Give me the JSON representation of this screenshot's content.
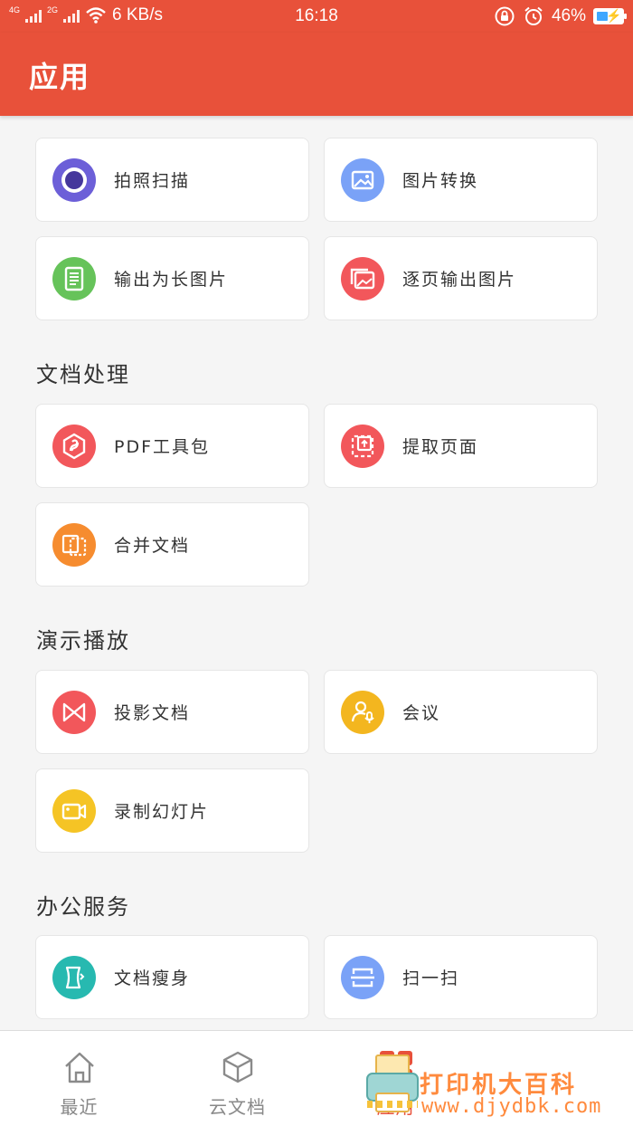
{
  "status_bar": {
    "network_1": "4G",
    "network_2": "2G",
    "speed": "6 KB/s",
    "time": "16:18",
    "battery": "46%",
    "battery_level": 0.46
  },
  "app_bar": {
    "title": "应用"
  },
  "sections": {
    "top": {
      "items": [
        {
          "label": "拍照扫描",
          "icon": "camera-scan-icon",
          "color": "#6c5fd8"
        },
        {
          "label": "图片转换",
          "icon": "image-icon",
          "color": "#7aa2f7"
        },
        {
          "label": "输出为长图片",
          "icon": "long-image-icon",
          "color": "#66c35a"
        },
        {
          "label": "逐页输出图片",
          "icon": "pages-image-icon",
          "color": "#f2575b"
        }
      ]
    },
    "doc_processing": {
      "title": "文档处理",
      "items": [
        {
          "label": "PDF工具包",
          "icon": "pdf-toolkit-icon",
          "color": "#f2575b"
        },
        {
          "label": "提取页面",
          "icon": "extract-page-icon",
          "color": "#f2575b"
        },
        {
          "label": "合并文档",
          "icon": "merge-document-icon",
          "color": "#f68c2f"
        }
      ]
    },
    "presentation": {
      "title": "演示播放",
      "items": [
        {
          "label": "投影文档",
          "icon": "projection-icon",
          "color": "#f2575b"
        },
        {
          "label": "会议",
          "icon": "meeting-icon",
          "color": "#f3b61f"
        },
        {
          "label": "录制幻灯片",
          "icon": "record-video-icon",
          "color": "#f5c425"
        }
      ]
    },
    "office": {
      "title": "办公服务",
      "items": [
        {
          "label": "文档瘦身",
          "icon": "slim-document-icon",
          "color": "#27b9b0"
        },
        {
          "label": "扫一扫",
          "icon": "qr-scan-icon",
          "color": "#7aa2f7"
        }
      ]
    }
  },
  "tabs": [
    {
      "label": "最近",
      "icon": "home-icon"
    },
    {
      "label": "云文档",
      "icon": "cube-icon"
    },
    {
      "label": "应用",
      "icon": "apps-grid-icon",
      "active": true
    }
  ],
  "watermark": {
    "text": "打印机大百科",
    "url": "www.djydbk.com"
  },
  "colors": {
    "accent": "#e8513a",
    "background": "#f5f5f5"
  }
}
